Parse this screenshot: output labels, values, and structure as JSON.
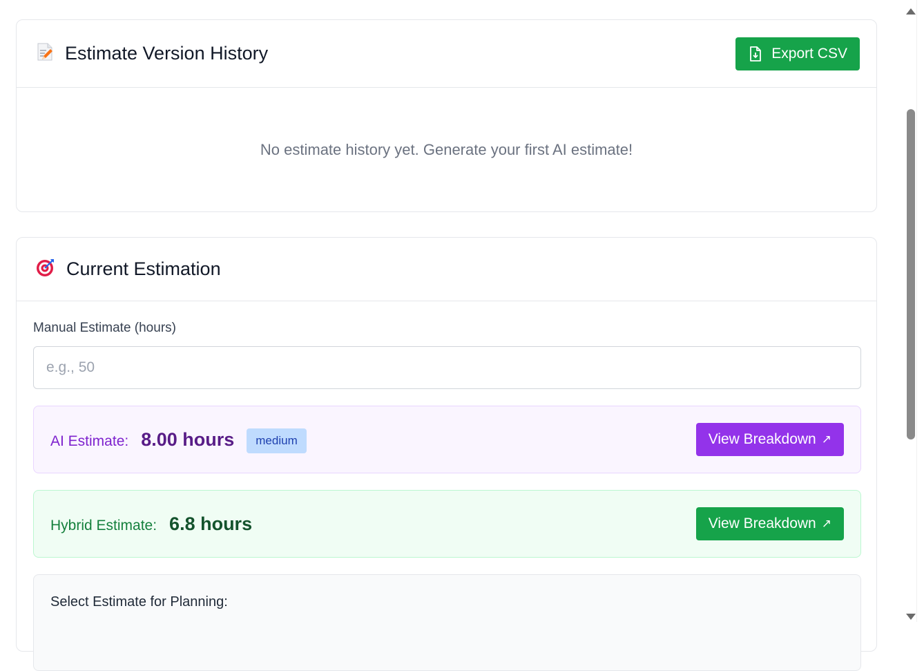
{
  "history": {
    "icon": "memo-icon",
    "title": "Estimate Version History",
    "export_label": "Export CSV",
    "empty_message": "No estimate history yet. Generate your first AI estimate!"
  },
  "current": {
    "icon": "target-icon",
    "title": "Current Estimation",
    "manual_label": "Manual Estimate (hours)",
    "manual_value": "",
    "manual_placeholder": "e.g., 50",
    "ai": {
      "label": "AI Estimate:",
      "value": "8.00 hours",
      "badge": "medium",
      "button": "View Breakdown",
      "button_icon": "↗"
    },
    "hybrid": {
      "label": "Hybrid Estimate:",
      "value": "6.8 hours",
      "button": "View Breakdown",
      "button_icon": "↗"
    },
    "select_label": "Select Estimate for Planning:"
  },
  "colors": {
    "green": "#16a34a",
    "purple": "#9333ea",
    "ai_bg": "#faf5ff",
    "hybrid_bg": "#f0fdf4"
  }
}
